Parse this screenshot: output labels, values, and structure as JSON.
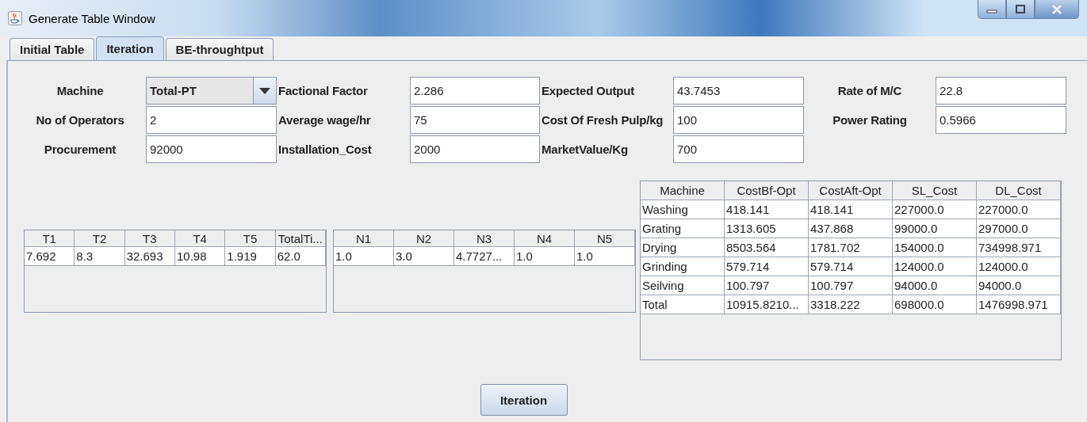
{
  "window": {
    "title": "Generate Table Window"
  },
  "tabs": [
    {
      "label": "Initial Table",
      "selected": false
    },
    {
      "label": "Iteration",
      "selected": true
    },
    {
      "label": "BE-throughtput",
      "selected": false
    }
  ],
  "form": [
    [
      {
        "label": "Machine",
        "kind": "combo",
        "value": "Total-PT"
      },
      {
        "label": "Factional Factor",
        "kind": "text",
        "value": "2.286"
      },
      {
        "label": "Expected Output",
        "kind": "text",
        "value": "43.7453"
      },
      {
        "label": "Rate of M/C",
        "kind": "text",
        "value": "22.8"
      }
    ],
    [
      {
        "label": "No of Operators",
        "kind": "text",
        "value": "2"
      },
      {
        "label": "Average wage/hr",
        "kind": "text",
        "value": "75"
      },
      {
        "label": "Cost Of Fresh Pulp/kg",
        "kind": "text",
        "value": "100"
      },
      {
        "label": "Power Rating",
        "kind": "text",
        "value": "0.5966"
      }
    ],
    [
      {
        "label": "Procurement",
        "kind": "text",
        "value": "92000"
      },
      {
        "label": "Installation_Cost",
        "kind": "text",
        "value": "2000"
      },
      {
        "label": "MarketValue/Kg",
        "kind": "text",
        "value": "700"
      }
    ]
  ],
  "time_table": {
    "columns": [
      "T1",
      "T2",
      "T3",
      "T4",
      "T5",
      "TotalTi..."
    ],
    "rows": [
      [
        "7.692",
        "8.3",
        "32.693",
        "10.98",
        "1.919",
        "62.0"
      ]
    ]
  },
  "n_table": {
    "columns": [
      "N1",
      "N2",
      "N3",
      "N4",
      "N5"
    ],
    "rows": [
      [
        "1.0",
        "3.0",
        "4.7727...",
        "1.0",
        "1.0"
      ]
    ]
  },
  "cost_table": {
    "columns": [
      "Machine",
      "CostBf-Opt",
      "CostAft-Opt",
      "SL_Cost",
      "DL_Cost"
    ],
    "rows": [
      [
        "Washing",
        "418.141",
        "418.141",
        "227000.0",
        "227000.0"
      ],
      [
        "Grating",
        "1313.605",
        "437.868",
        "99000.0",
        "297000.0"
      ],
      [
        "Drying",
        "8503.564",
        "1781.702",
        "154000.0",
        "734998.971"
      ],
      [
        "Grinding",
        "579.714",
        "579.714",
        "124000.0",
        "124000.0"
      ],
      [
        "Seilving",
        "100.797",
        "100.797",
        "94000.0",
        "94000.0"
      ],
      [
        "Total",
        "10915.8210...",
        "3318.222",
        "698000.0",
        "1476998.971"
      ]
    ]
  },
  "buttons": [
    "Iteration"
  ]
}
